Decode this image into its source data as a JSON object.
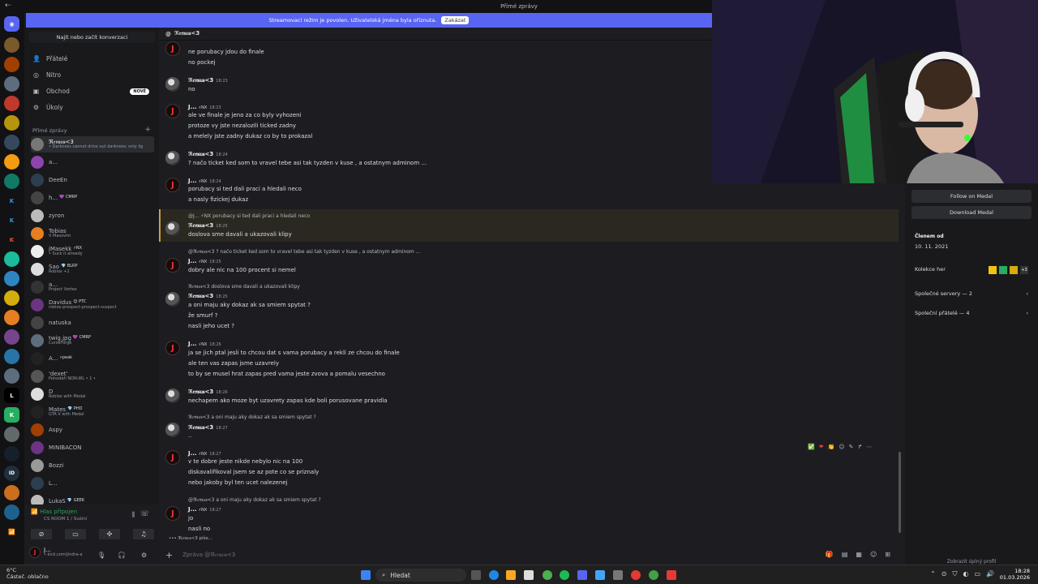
{
  "window": {
    "title": "Přímé zprávy",
    "back": "⇠"
  },
  "banner": {
    "text": "Streamovací režim je povolen. Uživatelská jména byla ořiznuta.",
    "button": "Zakázat"
  },
  "dm_panel": {
    "find": "Najít nebo začít konverzaci",
    "nav": [
      {
        "label": "Přátelé",
        "icon": "friends-icon"
      },
      {
        "label": "Nitro",
        "icon": "nitro-icon"
      },
      {
        "label": "Obchod",
        "icon": "shop-icon",
        "badge": "NOVÉ"
      },
      {
        "label": "Úkoly",
        "icon": "quests-icon"
      }
    ],
    "section": "Přímé zprávy",
    "dms": [
      {
        "name": "ℜ𝔢𝔫𝔰𝔲𝔰<3",
        "sub": "• Darkness cannot drive out darkness; only lig",
        "color": "#777",
        "sel": true
      },
      {
        "name": "a...",
        "sub": "",
        "color": "#8e44ad"
      },
      {
        "name": "DeeEn",
        "sub": "",
        "color": "#2c3e50"
      },
      {
        "name": "h...",
        "tag": "💜 CMRP",
        "sub": "",
        "color": "#444"
      },
      {
        "name": "zyron",
        "sub": "",
        "color": "#bbb"
      },
      {
        "name": "Tobias",
        "sub": "V Masovim",
        "color": "#e67e22"
      },
      {
        "name": "jMasekk",
        "tag": "⚡NX",
        "sub": "• Suck it already",
        "color": "#eee"
      },
      {
        "name": "Sao",
        "tag": "💎 BLRP",
        "sub": "Roblox +1",
        "color": "#ddd"
      },
      {
        "name": "a...",
        "sub": "Project Vortex",
        "color": "#333"
      },
      {
        "name": "Davidus",
        "tag": "😊 PTC",
        "sub": "roblox-prospect-prospect-suspect",
        "color": "#6c3483"
      },
      {
        "name": "natuska",
        "sub": "",
        "color": "#444"
      },
      {
        "name": "twig.jpg",
        "tag": "💜 CMRP",
        "sub": "CurseForge",
        "color": "#5d6d7e"
      },
      {
        "name": "A...",
        "tag": "⚡peak",
        "sub": "",
        "color": "#222"
      },
      {
        "name": "'dexet'",
        "sub": "Pohodáři NON-WL • 1 •",
        "color": "#555"
      },
      {
        "name": "D",
        "sub": "Roblox with Medal",
        "color": "#ddd"
      },
      {
        "name": "Mates",
        "tag": "💎 PHD",
        "sub": "GTA V with Medal",
        "color": "#222"
      },
      {
        "name": "Aspy",
        "sub": "",
        "color": "#a04000"
      },
      {
        "name": "MINIBACON",
        "sub": "",
        "color": "#6c3483"
      },
      {
        "name": "Bozzi",
        "sub": "",
        "color": "#999"
      },
      {
        "name": "L...",
        "sub": "",
        "color": "#2c3e50"
      },
      {
        "name": "LukaS",
        "tag": "💎 GEEK",
        "sub": "",
        "color": "#bbb"
      }
    ]
  },
  "voice": {
    "status": "Hlas připojen",
    "channel": "CS ROOM 1 / Sušiní"
  },
  "user": {
    "name": "J...",
    "status": "• kick.com/jindra-a"
  },
  "chat": {
    "header": "ℜ𝔢𝔫𝔰𝔲𝔰<3",
    "r_name": "ℜ𝔢𝔫𝔰𝔲𝔰<3",
    "j_name": "J...",
    "badge": "⚡NX",
    "composer": "Zpráva @ℜ𝔢𝔫𝔰𝔲𝔰<3",
    "l_top1": "ne porubacy jdou do finale",
    "l_top2": "no pockej",
    "t1": "18:23",
    "m1": "no",
    "t2": "18:23",
    "m2a": "ale ve finale je jeno za co byly vyhozeni",
    "m2b": "protoze vy jste nezalozili ticked zadny",
    "m2c": "a melely jste zadny dukaz co by to prokazal",
    "t3": "18:24",
    "m3": "? načo ticket ked som to vravel tebe asi  tak tyzden v kuse , a ostatnym adminom ...",
    "t4": "18:24",
    "m4a": "porubacy si ted dali praci a hledali neco",
    "m4b": "a nasly fizickej dukaz",
    "rp5": "@J... ⚡NX porubacy si ted dali praci a hledali neco",
    "t5": "18:25",
    "m5": "doslova sme davali a ukazovali klipy",
    "rp6": "@ℜ𝔢𝔫𝔰𝔲𝔰<3 ? načo ticket ked som to vravel tebe asi  tak tyzden v kuse , a ostatnym adminom ...",
    "t6": "18:25",
    "m6": "dobry ale nic na 100 procent si nemel",
    "rp7": "ℜ𝔢𝔫𝔰𝔲𝔰<3 doslova sme davali a ukazovali klipy",
    "t7": "18:25",
    "m7a": "a oni maju aky dokaz ak sa smiem spytat ?",
    "m7b": "že smurf ?",
    "m7c": "nasli jeho ucet ?",
    "t8": "18:26",
    "m8a": "ja se jich ptal jesli to chcou dat s vama porubacy a rekli ze chcou do finale",
    "m8b": "ale ten vas zapas jsme uzavrely",
    "m8c": "to by se musel hrat zapas pred vama jeste zvova a pomalu vesechno",
    "t9": "18:26",
    "m9": "nechapem ako moze byt uzavrety zapas kde boli porusovane pravidla",
    "rp10": "ℜ𝔢𝔫𝔰𝔲𝔰<3 a oni maju aky dokaz ak sa smiem spytat ?",
    "t10": "18:27",
    "m10": "..",
    "t11": "18:27",
    "m11a": "v te dobre jeste nikde nebylo nic na 100",
    "m11b": "diskavalifikoval jsem se az pote co se priznaly",
    "m11c": "nebo jakoby byl ten ucet nalezenej",
    "rp12": "@ℜ𝔢𝔫𝔰𝔲𝔰<3 a oni maju aky dokaz ak sa smiem spytat ?",
    "t12": "18:27",
    "m12a": "jo",
    "m12b": "nasli no",
    "typing": "ℜ𝔢𝔫𝔰𝔲𝔰<3 píše..."
  },
  "profile": {
    "follow": "Follow on Medal",
    "download": "Download Medal",
    "member_label": "Členem od",
    "member_date": "10. 11. 2021",
    "collection": "Kolekce her",
    "collection_more": "+3",
    "servers": "Společné servery — 2",
    "friends": "Společní přátelé — 4",
    "footer": "Zobrazit úplný profil"
  },
  "taskbar": {
    "search": "Hledat",
    "temp": "6°C",
    "weather": "Částeč. oblačno",
    "time": "18:28",
    "date": "01.03.2026"
  }
}
